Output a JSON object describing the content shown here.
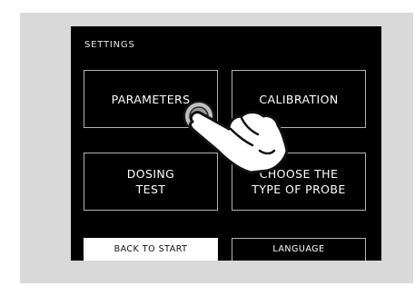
{
  "screen": {
    "title": "SETTINGS",
    "tiles": {
      "parameters": "PARAMETERS",
      "calibration": "CALIBRATION",
      "dosing_test": "DOSING\nTEST",
      "probe_type": "CHOOSE THE\nTYPE OF PROBE"
    },
    "back_to_start": "BACK TO START",
    "language": "LANGUAGE"
  },
  "icons": {
    "pointer": "hand-pointer-icon",
    "tap_indicator": "tap-indicator-icon"
  },
  "colors": {
    "screen_bg": "#000000",
    "panel_bg": "#d9d9d9",
    "tile_border": "#b3b3b3",
    "text": "#ffffff"
  }
}
